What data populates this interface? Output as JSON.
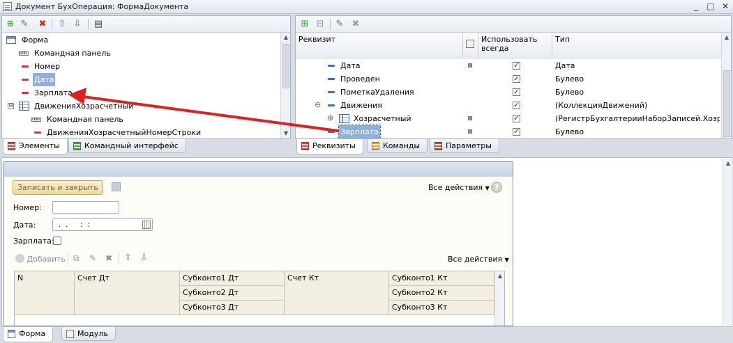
{
  "window": {
    "title": "Документ БухОперация: ФормаДокумента",
    "controls": [
      "_",
      "□",
      "✕"
    ]
  },
  "elements_panel": {
    "tree": [
      {
        "label": "Форма",
        "icon": "form-icon",
        "level": 0
      },
      {
        "label": "Командная панель",
        "icon": "command-panel-icon",
        "level": 1
      },
      {
        "label": "Номер",
        "icon": "field-icon",
        "level": 1
      },
      {
        "label": "Дата",
        "icon": "field-icon",
        "level": 1,
        "selected": true
      },
      {
        "label": "Зарплата",
        "icon": "field-icon",
        "level": 1
      },
      {
        "label": "ДвиженияХозрасчетный",
        "icon": "table-icon",
        "level": 1,
        "expander": "⊖"
      },
      {
        "label": "Командная панель",
        "icon": "command-panel-icon",
        "level": 2
      },
      {
        "label": "ДвиженияХозрасчетныйНомерСтроки",
        "icon": "field-icon",
        "level": 2
      }
    ],
    "tabs": [
      {
        "label": "Элементы",
        "active": true
      },
      {
        "label": "Командный интерфейс",
        "active": false
      }
    ]
  },
  "attributes_panel": {
    "headers": {
      "attribute": "Реквизит",
      "use_always": "Использовать всегда",
      "type": "Тип"
    },
    "rows": [
      {
        "name": "Дата",
        "type": "Дата",
        "checked": true
      },
      {
        "name": "Проведен",
        "type": "Булево",
        "checked": true
      },
      {
        "name": "ПометкаУдаления",
        "type": "Булево",
        "checked": true
      },
      {
        "name": "Движения",
        "type": "(КоллекцияДвижений)",
        "checked": true,
        "expander": "⊖"
      },
      {
        "name": "Хозрасчетный",
        "type": "(РегистрБухгалтерииНаборЗаписей.Хозрас...",
        "checked": true,
        "expander": "⊕"
      },
      {
        "name": "Зарплата",
        "type": "Булево",
        "checked": true,
        "selected": true
      }
    ],
    "tabs": [
      {
        "label": "Реквизиты",
        "active": true
      },
      {
        "label": "Команды",
        "active": false
      },
      {
        "label": "Параметры",
        "active": false
      }
    ]
  },
  "preview_form": {
    "save_close_button": "Записать и закрыть",
    "all_actions": "Все действия",
    "help": "?",
    "number_label": "Номер:",
    "date_label": "Дата:",
    "date_placeholder": " .  .     :  :",
    "salary_label": "Зарплата:",
    "table_toolbar": {
      "add": "Добавить",
      "all_actions": "Все действия"
    },
    "table_columns": {
      "n": "N",
      "debit_account": "Счет Дт",
      "subconto1_dt": "Субконто1 Дт",
      "subconto2_dt": "Субконто2 Дт",
      "subconto3_dt": "Субконто3 Дт",
      "credit_account": "Счет Кт",
      "subconto1_kt": "Субконто1 Кт",
      "subconto2_kt": "Субконто2 Кт",
      "subconto3_kt": "Субконто3 Кт"
    }
  },
  "bottom_tabs": [
    {
      "label": "Форма",
      "active": true
    },
    {
      "label": "Модуль",
      "active": false
    }
  ],
  "colors": {
    "arrow": "#e02020",
    "selection": "#8db0dc"
  }
}
